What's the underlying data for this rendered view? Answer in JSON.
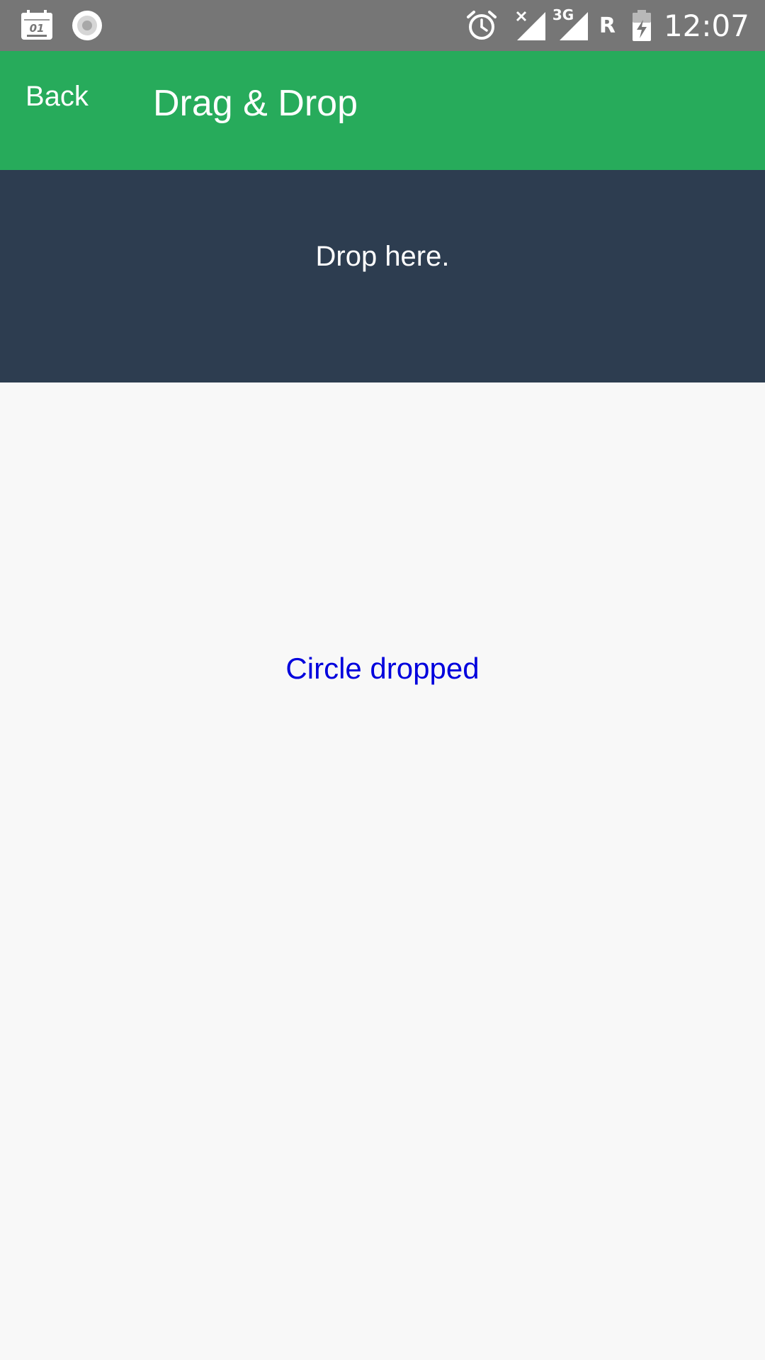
{
  "status_bar": {
    "time": "12:07",
    "roaming_indicator": "R",
    "network_type": "3G",
    "calendar_day": "01",
    "icons": [
      "calendar-notification-icon",
      "record-icon",
      "alarm-icon",
      "no-signal-icon",
      "signal-3g-icon",
      "battery-charging-icon"
    ]
  },
  "app_bar": {
    "back_label": "Back",
    "title": "Drag & Drop",
    "color": "#27ab5b"
  },
  "drop_zone": {
    "label": "Drop here.",
    "color": "#2d3d50"
  },
  "content": {
    "status_message": "Circle dropped",
    "status_color": "#0000dd"
  }
}
